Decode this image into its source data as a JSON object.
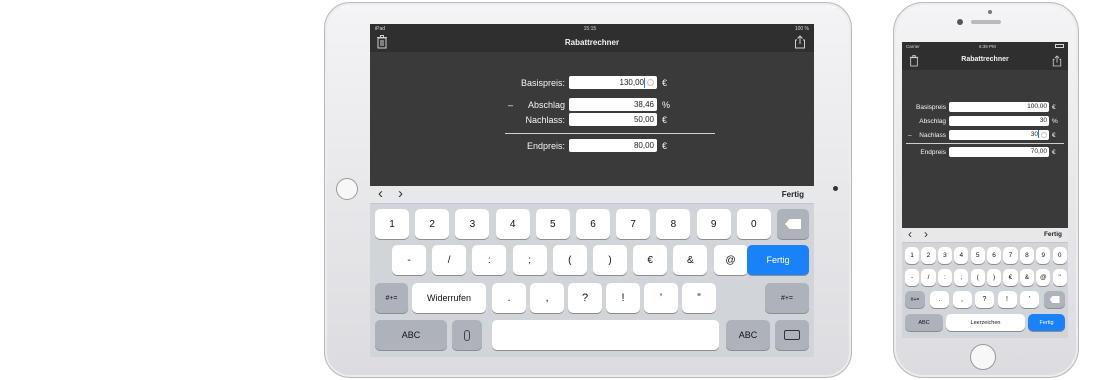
{
  "ipad": {
    "status": {
      "device": "iPad",
      "time": "15:15",
      "battery": "100 %"
    },
    "title": "Rabattrechner",
    "rows": [
      {
        "prefix": "",
        "label": "Basispreis:",
        "value": "130,00",
        "unit": "€"
      },
      {
        "prefix": "–",
        "label": "Abschlag",
        "value": "38,46",
        "unit": "%"
      },
      {
        "prefix": "",
        "label": "Nachlass:",
        "value": "50,00",
        "unit": "€"
      },
      {
        "prefix": "",
        "label": "Endpreis:",
        "value": "80,00",
        "unit": "€"
      }
    ],
    "toolbar": {
      "prev": "‹",
      "next": "›",
      "done": "Fertig"
    },
    "keys_row1": [
      "1",
      "2",
      "3",
      "4",
      "5",
      "6",
      "7",
      "8",
      "9",
      "0"
    ],
    "keys_row2": [
      "-",
      "/",
      ":",
      ";",
      "(",
      ")",
      "€",
      "&",
      "@"
    ],
    "return_label": "Fertig",
    "keys_row3": [
      "#+=",
      "Widerrufen",
      ".",
      ",",
      "?",
      "!",
      "’",
      "”",
      "#+="
    ],
    "abc_label": "ABC",
    "abc_label_right": "ABC"
  },
  "iphone": {
    "status": {
      "carrier": "Carrier",
      "time": "6:39 PM"
    },
    "title": "Rabattrechner",
    "rows": [
      {
        "prefix": "",
        "label": "Basispreis",
        "value": "100,00",
        "unit": "€"
      },
      {
        "prefix": "",
        "label": "Abschlag",
        "value": "30",
        "unit": "%"
      },
      {
        "prefix": "–",
        "label": "Nachlass",
        "value": "30",
        "unit": "€"
      },
      {
        "prefix": "",
        "label": "Endpreis",
        "value": "70,00",
        "unit": "€"
      }
    ],
    "toolbar": {
      "prev": "‹",
      "next": "›",
      "done": "Fertig"
    },
    "keys_row1": [
      "1",
      "2",
      "3",
      "4",
      "5",
      "6",
      "7",
      "8",
      "9",
      "0"
    ],
    "keys_row2": [
      "-",
      "/",
      ":",
      ";",
      "(",
      ")",
      "€",
      "&",
      "@",
      "\""
    ],
    "keys_row3": [
      "#+=",
      ".",
      ",",
      "?",
      "!",
      "’"
    ],
    "abc_label": "ABC",
    "space_label": "Leerzeichen",
    "return_label": "Fertig"
  }
}
